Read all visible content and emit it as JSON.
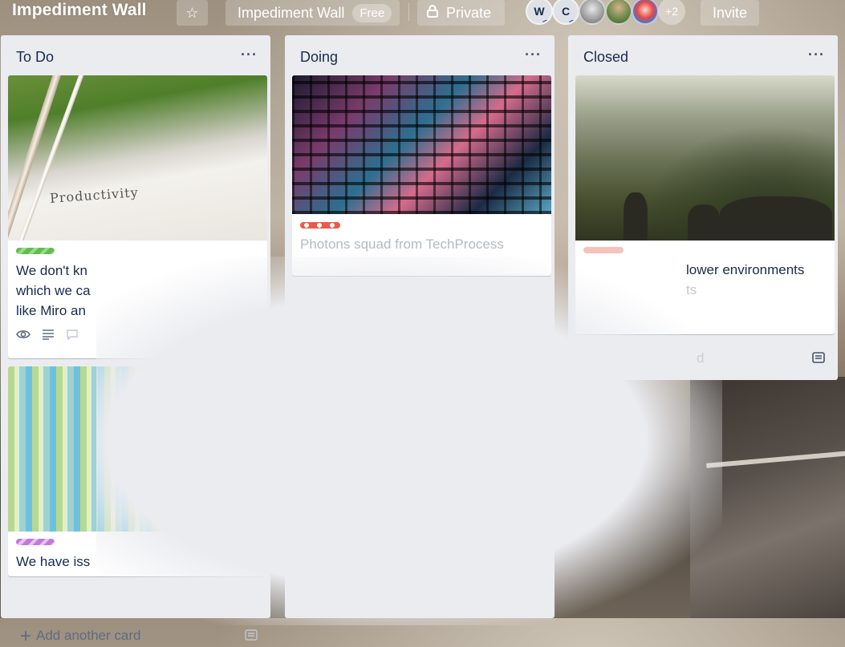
{
  "header": {
    "board_title": "Impediment Wall",
    "star_icon": "☆",
    "board_name_button": "Impediment Wall",
    "plan_badge": "Free",
    "visibility_label": "Private",
    "members": [
      {
        "initial": "W"
      },
      {
        "initial": "C"
      }
    ],
    "more_members": "+2",
    "invite_label": "Invite"
  },
  "lists": [
    {
      "title": "To Do",
      "cards": [
        {
          "cover_text": "Productivity",
          "label_color": "#61bd4f",
          "text_lines": [
            "We don't kn",
            "which we ca",
            "like Miro an"
          ]
        },
        {
          "label_color": "#c377e0",
          "text_lines": [
            "We have iss"
          ]
        }
      ],
      "add_card_label": "Add another card"
    },
    {
      "title": "Doing",
      "cards": [
        {
          "label_color": "#eb5a46",
          "text_lines": [
            "Photons squad from TechProcess"
          ]
        }
      ]
    },
    {
      "title": "Closed",
      "cards": [
        {
          "label_color": "#eb5a46",
          "text_lines": [
            "lower environments",
            "ts"
          ]
        }
      ],
      "add_card_label": "d"
    }
  ],
  "colors": {
    "list_bg": "#ebecf0",
    "text_primary": "#172b4d",
    "text_muted": "#5e6c84"
  },
  "icons": {
    "star": "star-icon",
    "lock": "lock-icon",
    "eye": "eye-icon",
    "description": "description-icon",
    "comment": "comment-icon",
    "plus": "plus-icon",
    "template": "card-template-icon",
    "menu": "list-menu-icon"
  }
}
